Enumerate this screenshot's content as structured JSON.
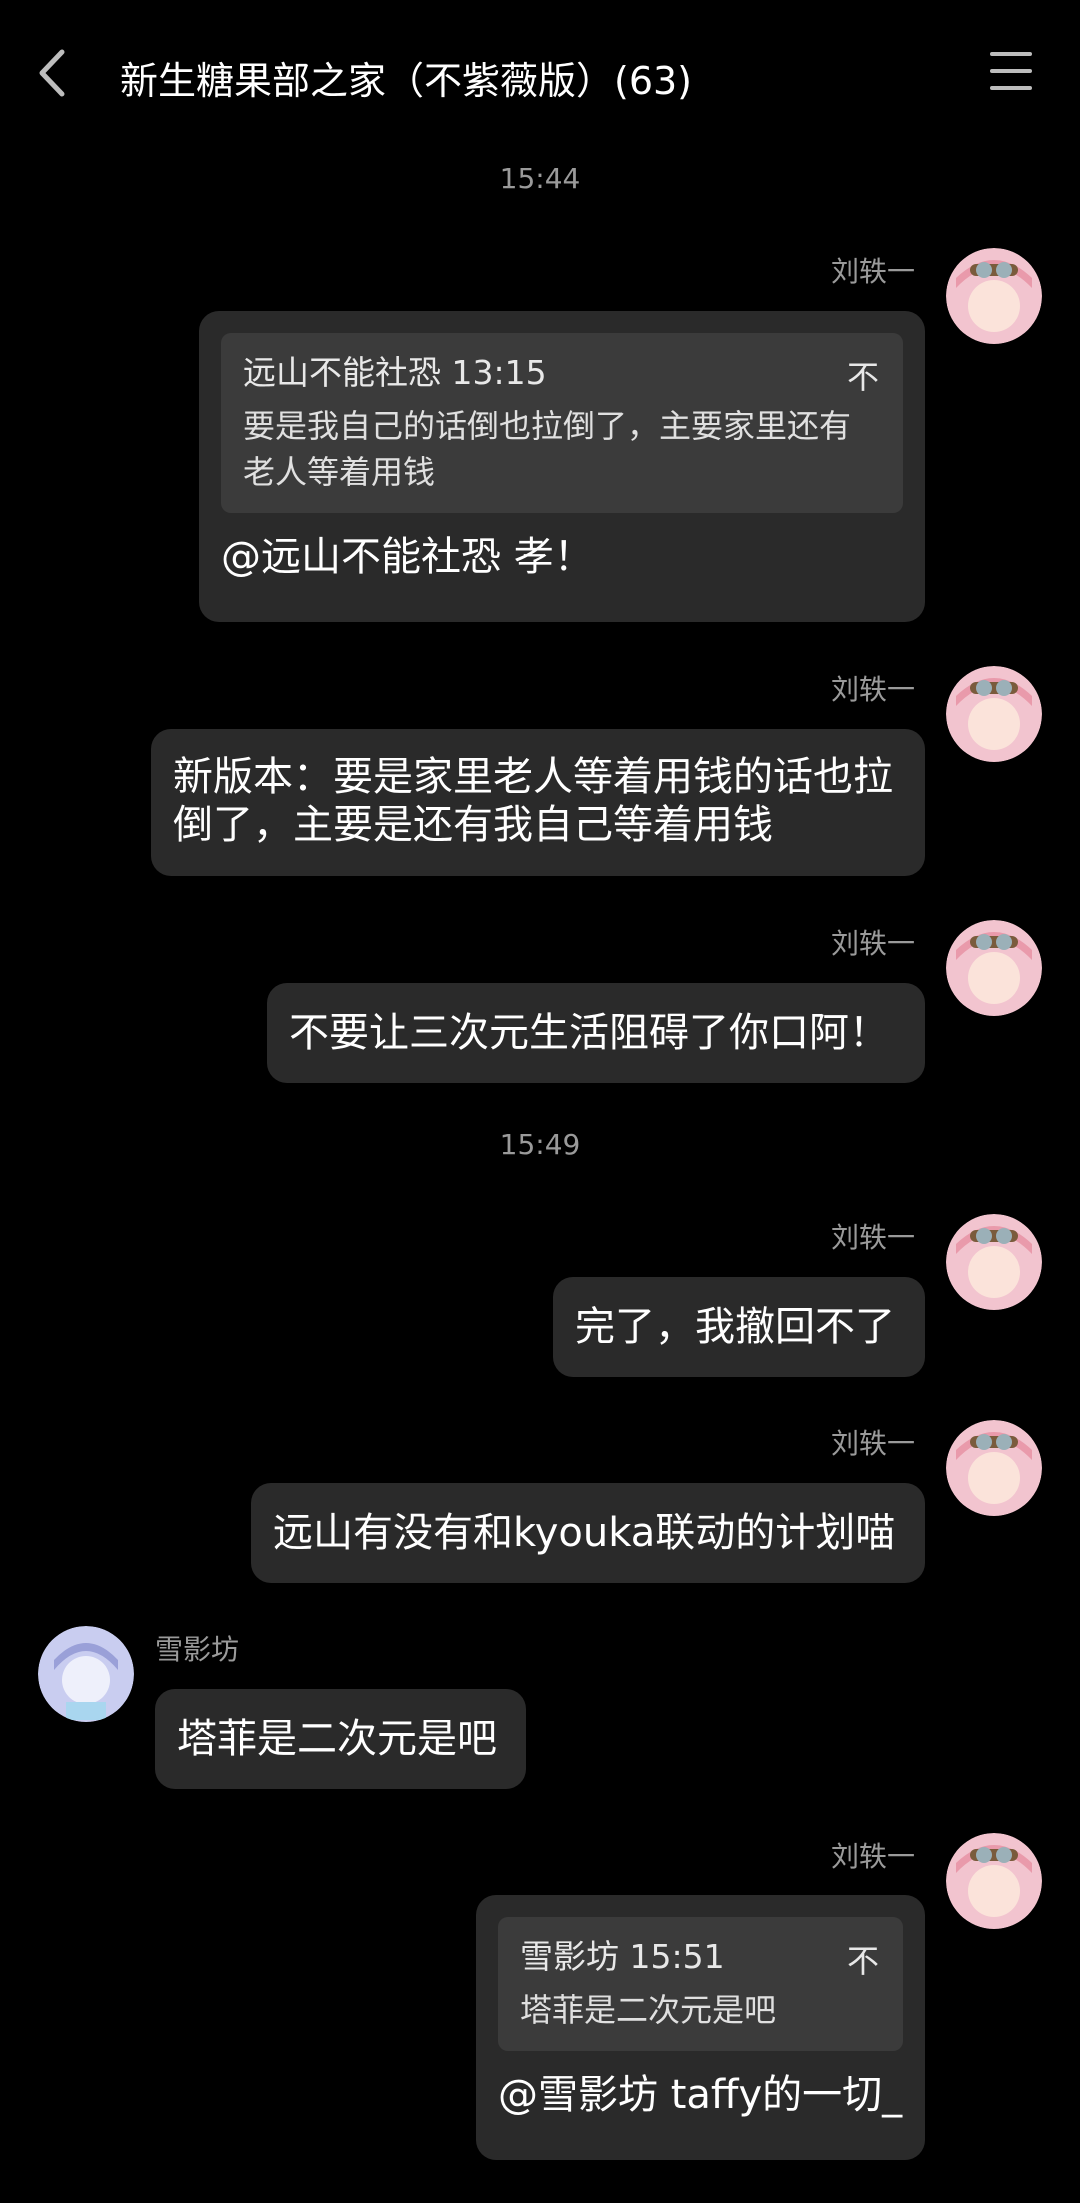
{
  "header": {
    "title": "新生糖果部之家（不紫薇版）(63)"
  },
  "timestamps": [
    "15:44",
    "15:49"
  ],
  "messages": [
    {
      "sender": "刘轶一",
      "quote": {
        "header": "远山不能社恐 13:15",
        "close": "不",
        "text": "要是我自己的话倒也拉倒了，主要家里还有老人等着用钱"
      },
      "text": "@远山不能社恐 孝！"
    },
    {
      "sender": "刘轶一",
      "text": "新版本：要是家里老人等着用钱的话也拉倒了，主要是还有我自己等着用钱"
    },
    {
      "sender": "刘轶一",
      "text": "不要让三次元生活阻碍了你口阿！"
    },
    {
      "sender": "刘轶一",
      "text": "完了，我撤回不了"
    },
    {
      "sender": "刘轶一",
      "text": "远山有没有和kyouka联动的计划喵"
    },
    {
      "sender": "雪影坊",
      "text": "塔菲是二次元是吧"
    },
    {
      "sender": "刘轶一",
      "quote": {
        "header": "雪影坊 15:51",
        "close": "不",
        "text": "塔菲是二次元是吧"
      },
      "text": "@雪影坊 taffy的一切_"
    }
  ],
  "colors": {
    "background": "#000000",
    "bubble": "#2a2a2a",
    "quote": "#3b3b3b",
    "meta_text": "#9a9a9a"
  }
}
